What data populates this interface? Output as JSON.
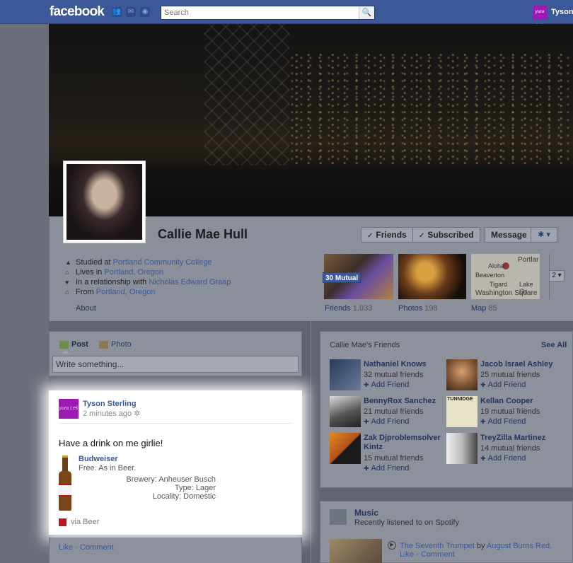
{
  "topbar": {
    "logo": "facebook",
    "search_placeholder": "Search",
    "user_name": "Tyson",
    "user_avatar_text": "yura Lek"
  },
  "profile": {
    "name": "Callie Mae Hull",
    "buttons": {
      "friends": "Friends",
      "subscribed": "Subscribed",
      "message": "Message"
    },
    "info": {
      "studied_prefix": "Studied at ",
      "studied_link": "Portland Community College",
      "lives_prefix": "Lives in ",
      "lives_link": "Portland, Oregon",
      "rel_prefix": "In a relationship with ",
      "rel_link": "Nicholas Edward Graap",
      "from_prefix": "From ",
      "from_link": "Portland, Oregon"
    },
    "about": "About",
    "thumbs": {
      "mutual_badge": "30 Mutual",
      "friends_label": "Friends",
      "friends_count": "1,033",
      "photos_label": "Photos",
      "photos_count": "198",
      "map_label": "Map",
      "map_count": "85",
      "map_place": "Washington Square",
      "map_cities": [
        "Portlar",
        "Aloha",
        "Beaverton",
        "Tigard",
        "Lake Os"
      ],
      "more_count": "2"
    }
  },
  "composer": {
    "post_tab": "Post",
    "photo_tab": "Photo",
    "placeholder": "Write something..."
  },
  "story": {
    "author": "Tyson Sterling",
    "avatar_text": "yura Lek",
    "time": "2 minutes ago",
    "message": "Have a drink on me girlie!",
    "beer_name": "Budweiser",
    "beer_tagline": "Free. As in Beer.",
    "brewery": "Brewery: Anheuser Busch",
    "type": "Type: Lager",
    "locality": "Locality: Domestic",
    "via": "via Beer",
    "like": "Like",
    "comment": "Comment"
  },
  "friends_box": {
    "title": "Callie Mae's Friends",
    "see_all": "See All",
    "add_label": "Add Friend",
    "friends": [
      {
        "name": "Nathaniel Knows",
        "mutual": "32 mutual friends"
      },
      {
        "name": "Jacob Israel Ashley",
        "mutual": "25 mutual friends"
      },
      {
        "name": "BennyRox Sanchez",
        "mutual": "21 mutual friends"
      },
      {
        "name": "Kellan Cooper",
        "mutual": "19 mutual friends"
      },
      {
        "name": "Zak Djproblemsolver Kintz",
        "mutual": "15 mutual friends"
      },
      {
        "name": "TreyZilla Martinez",
        "mutual": "14 mutual friends"
      }
    ],
    "thumb_text": "TUNNIDGE"
  },
  "music": {
    "title": "Music",
    "subtitle": "Recently listened to on Spotify",
    "track": "The Seventh Trumpet",
    "by": " by ",
    "artist": "August Burns Red.",
    "like": "Like",
    "comment": "Comment"
  }
}
